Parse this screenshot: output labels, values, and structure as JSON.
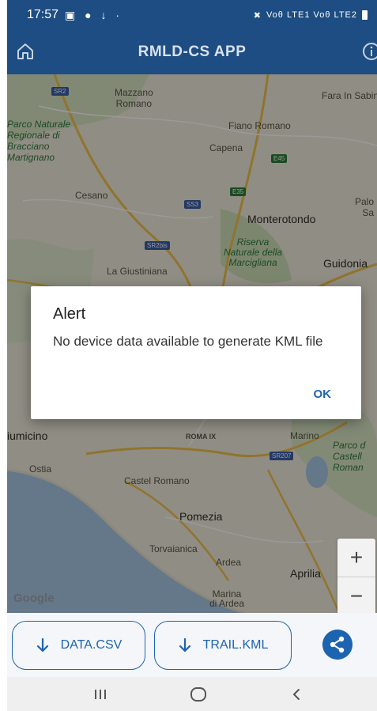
{
  "status_bar": {
    "time": "17:57",
    "network_text": "Voθ LTE1 Voθ LTE2"
  },
  "app_bar": {
    "title": "RMLD-CS APP"
  },
  "map": {
    "attribution": "Google",
    "labels": {
      "mazzano": "Mazzano\nRomano",
      "fara": "Fara In Sabina",
      "parco": "Parco Naturale\nRegionale di\nBracciano\nMartignano",
      "fiano": "Fiano Romano",
      "capena": "Capena",
      "cesano": "Cesano",
      "palombara": "Palo\nSa",
      "monterotondo": "Monterotondo",
      "riserva": "Riserva\nNaturale della\nMarcigliana",
      "guidonia": "Guidonia",
      "giustiniana": "La Giustiniana",
      "fiumicino": "iumicino",
      "roma_ix": "ROMA IX",
      "marino": "Marino",
      "parco_castelli": "Parco d\nCastell\nRoman",
      "ostia": "Ostia",
      "castel_romano": "Castel Romano",
      "pomezia": "Pomezia",
      "torvaianica": "Torvaianica",
      "ardea": "Ardea",
      "aprilia": "Aprilia",
      "marina_ardea": "Marina\ndi Ardea"
    },
    "shields": {
      "sr2": "SR2",
      "e45": "E45",
      "e35": "E35",
      "ss3": "SS3",
      "sr2bis": "SR2bis",
      "sr207": "SR207"
    },
    "zoom_in": "+",
    "zoom_out": "−"
  },
  "dialog": {
    "title": "Alert",
    "message": "No device data available to generate KML file",
    "ok_label": "OK"
  },
  "actions": {
    "data_csv_label": "DATA.CSV",
    "trail_kml_label": "TRAIL.KML"
  },
  "colors": {
    "primary": "#1d4d82",
    "accent": "#1d64b0"
  }
}
